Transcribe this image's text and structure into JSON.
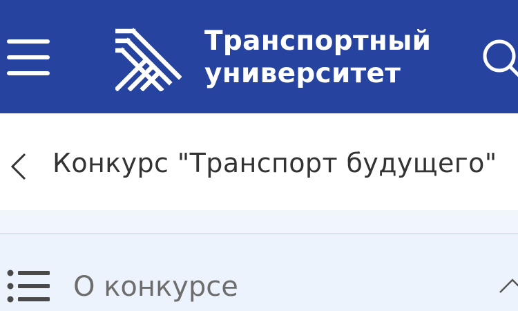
{
  "header": {
    "brand_line1": "Транспортный",
    "brand_line2": "университет",
    "menu_icon": "hamburger-menu-icon",
    "search_icon": "search-icon",
    "background_color": "#2743a0"
  },
  "titlebar": {
    "title": "Конкурс \"Транспорт будущего\"",
    "back_icon": "chevron-left-icon"
  },
  "accordion": {
    "title": "О конкурсе",
    "list_icon": "list-icon",
    "toggle_icon": "chevron-up-icon",
    "expanded": true
  }
}
